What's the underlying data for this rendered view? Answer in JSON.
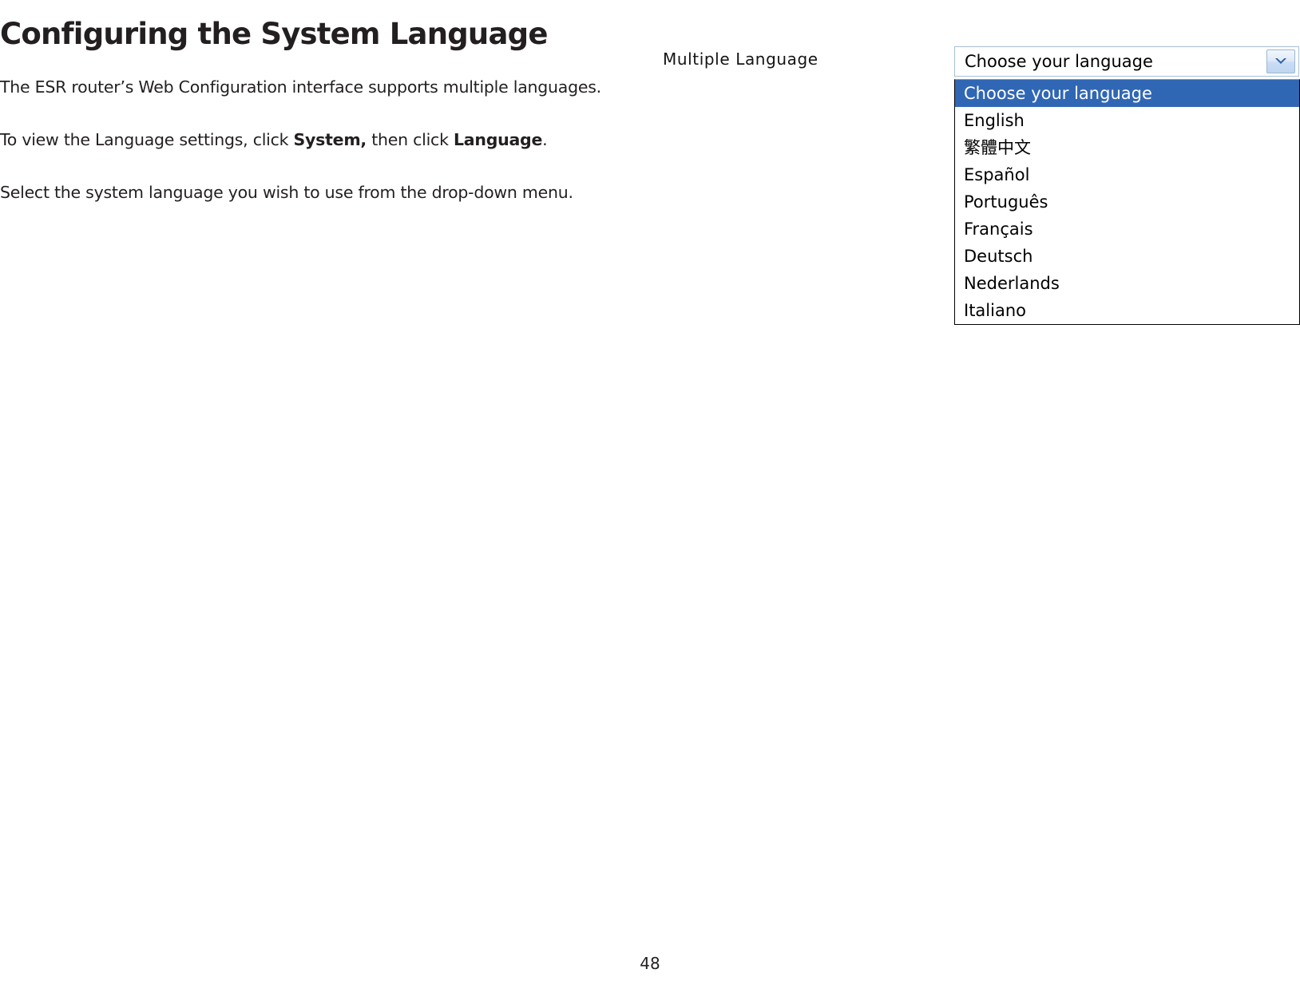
{
  "document": {
    "heading": "Configuring the System Language",
    "page_number": "48",
    "paragraphs": [
      {
        "id": "intro",
        "runs": [
          {
            "text": "The ESR router’s Web Configuration interface supports multiple languages.",
            "bold": false
          }
        ]
      },
      {
        "id": "navigate",
        "runs": [
          {
            "text": "To view the Language settings, click ",
            "bold": false
          },
          {
            "text": "System,",
            "bold": true
          },
          {
            "text": " then click ",
            "bold": false
          },
          {
            "text": "Language",
            "bold": true
          },
          {
            "text": ".",
            "bold": false
          }
        ]
      },
      {
        "id": "select",
        "runs": [
          {
            "text": "Select the system language you wish to use from the drop-down menu.",
            "bold": false
          }
        ]
      }
    ]
  },
  "screenshot": {
    "field_label": "Multiple Language",
    "combo": {
      "value": "Choose your language",
      "arrow_icon": "chevron-down-icon",
      "arrow_color": "#2b5797"
    },
    "options": [
      {
        "label": "Choose your language",
        "selected": true
      },
      {
        "label": "English",
        "selected": false
      },
      {
        "label": "繁體中文",
        "selected": false
      },
      {
        "label": "Español",
        "selected": false
      },
      {
        "label": "Português",
        "selected": false
      },
      {
        "label": "Français",
        "selected": false
      },
      {
        "label": "Deutsch",
        "selected": false
      },
      {
        "label": "Nederlands",
        "selected": false
      },
      {
        "label": "Italiano",
        "selected": false
      }
    ],
    "colors": {
      "highlight": "#3067b5",
      "highlight_text": "#ffffff",
      "combo_border": "#a8c0d8",
      "list_border": "#000000"
    }
  }
}
